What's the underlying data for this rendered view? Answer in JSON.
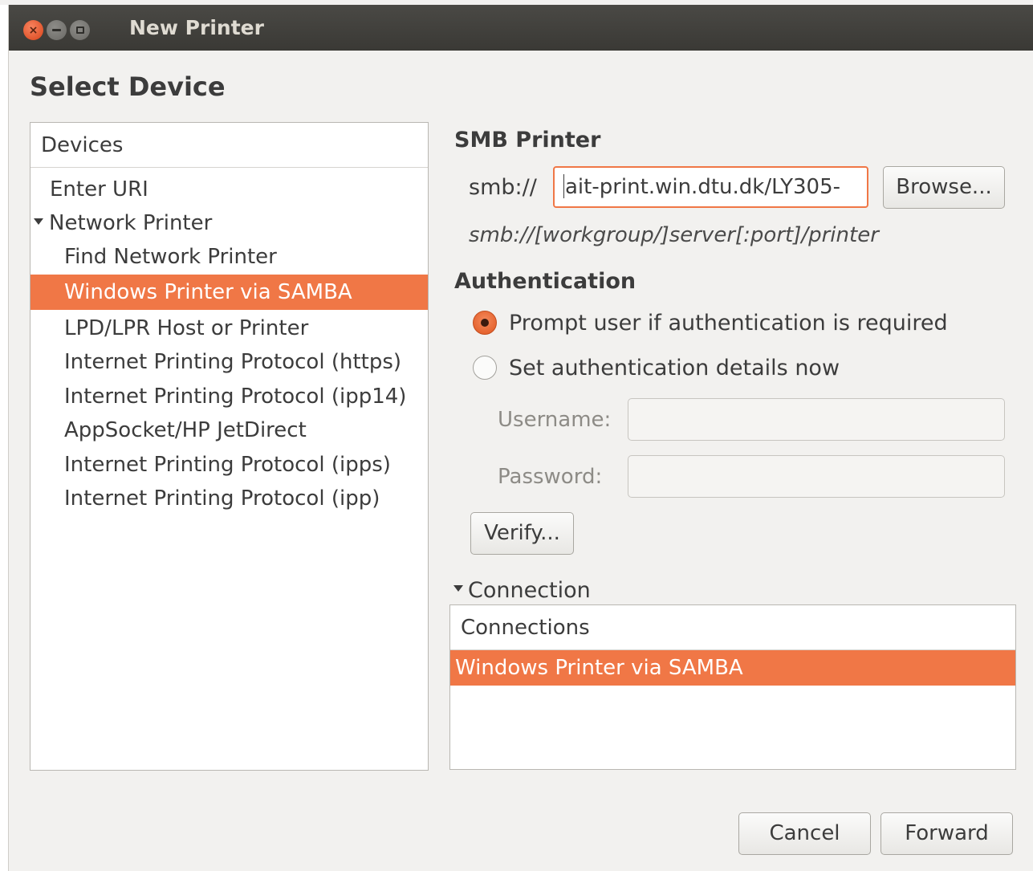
{
  "window": {
    "title": "New Printer",
    "close_glyph": "×"
  },
  "page": {
    "heading": "Select Device"
  },
  "devices": {
    "header": "Devices",
    "items": [
      {
        "label": "Enter URI",
        "level": 0,
        "expander": false,
        "selected": false
      },
      {
        "label": "Network Printer",
        "level": 0,
        "expander": true,
        "selected": false
      },
      {
        "label": "Find Network Printer",
        "level": 1,
        "expander": false,
        "selected": false
      },
      {
        "label": "Windows Printer via SAMBA",
        "level": 1,
        "expander": false,
        "selected": true
      },
      {
        "label": "LPD/LPR Host or Printer",
        "level": 1,
        "expander": false,
        "selected": false
      },
      {
        "label": "Internet Printing Protocol (https)",
        "level": 1,
        "expander": false,
        "selected": false
      },
      {
        "label": "Internet Printing Protocol (ipp14)",
        "level": 1,
        "expander": false,
        "selected": false
      },
      {
        "label": "AppSocket/HP JetDirect",
        "level": 1,
        "expander": false,
        "selected": false
      },
      {
        "label": "Internet Printing Protocol (ipps)",
        "level": 1,
        "expander": false,
        "selected": false
      },
      {
        "label": "Internet Printing Protocol (ipp)",
        "level": 1,
        "expander": false,
        "selected": false
      }
    ]
  },
  "smb": {
    "title": "SMB Printer",
    "prefix": "smb://",
    "uri_value": "ait-print.win.dtu.dk/LY305-",
    "browse_label": "Browse...",
    "hint": "smb://[workgroup/]server[:port]/printer"
  },
  "auth": {
    "title": "Authentication",
    "option_prompt": "Prompt user if authentication is required",
    "option_set": "Set authentication details now",
    "selected_option": "prompt",
    "username_label": "Username:",
    "username_value": "",
    "password_label": "Password:",
    "password_value": "",
    "verify_label": "Verify..."
  },
  "connection": {
    "expander_label": "Connection",
    "header": "Connections",
    "items": [
      "Windows Printer via SAMBA"
    ]
  },
  "footer": {
    "cancel_label": "Cancel",
    "forward_label": "Forward"
  },
  "colors": {
    "accent": "#f07746",
    "titlebar": "#3d3c38",
    "window_bg": "#f2f1ef"
  }
}
